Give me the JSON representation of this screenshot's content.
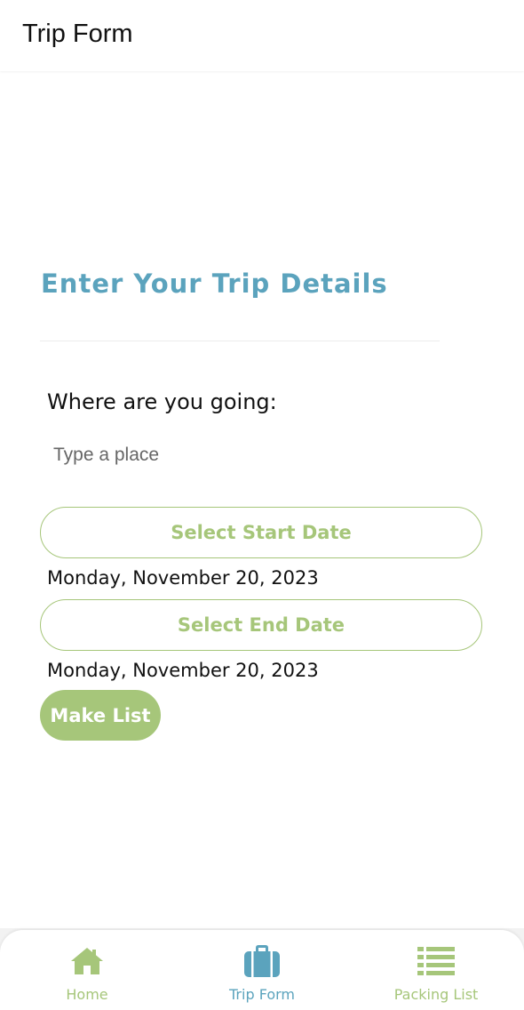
{
  "header": {
    "title": "Trip Form"
  },
  "form": {
    "heading": "Enter Your Trip Details",
    "destination_label": "Where are you going:",
    "destination_placeholder": "Type a place",
    "destination_value": "",
    "start_button_label": "Select Start Date",
    "start_date": "Monday, November 20, 2023",
    "end_button_label": "Select End Date",
    "end_date": "Monday, November 20, 2023",
    "submit_label": "Make List"
  },
  "bottom_nav": {
    "items": [
      {
        "label": "Home",
        "icon": "home-icon",
        "active": false
      },
      {
        "label": "Trip Form",
        "icon": "suitcase-icon",
        "active": true
      },
      {
        "label": "Packing List",
        "icon": "list-icon",
        "active": false
      }
    ]
  },
  "colors": {
    "accent_green": "#a6c67a",
    "accent_blue": "#5ba3bd",
    "text": "#111111"
  }
}
